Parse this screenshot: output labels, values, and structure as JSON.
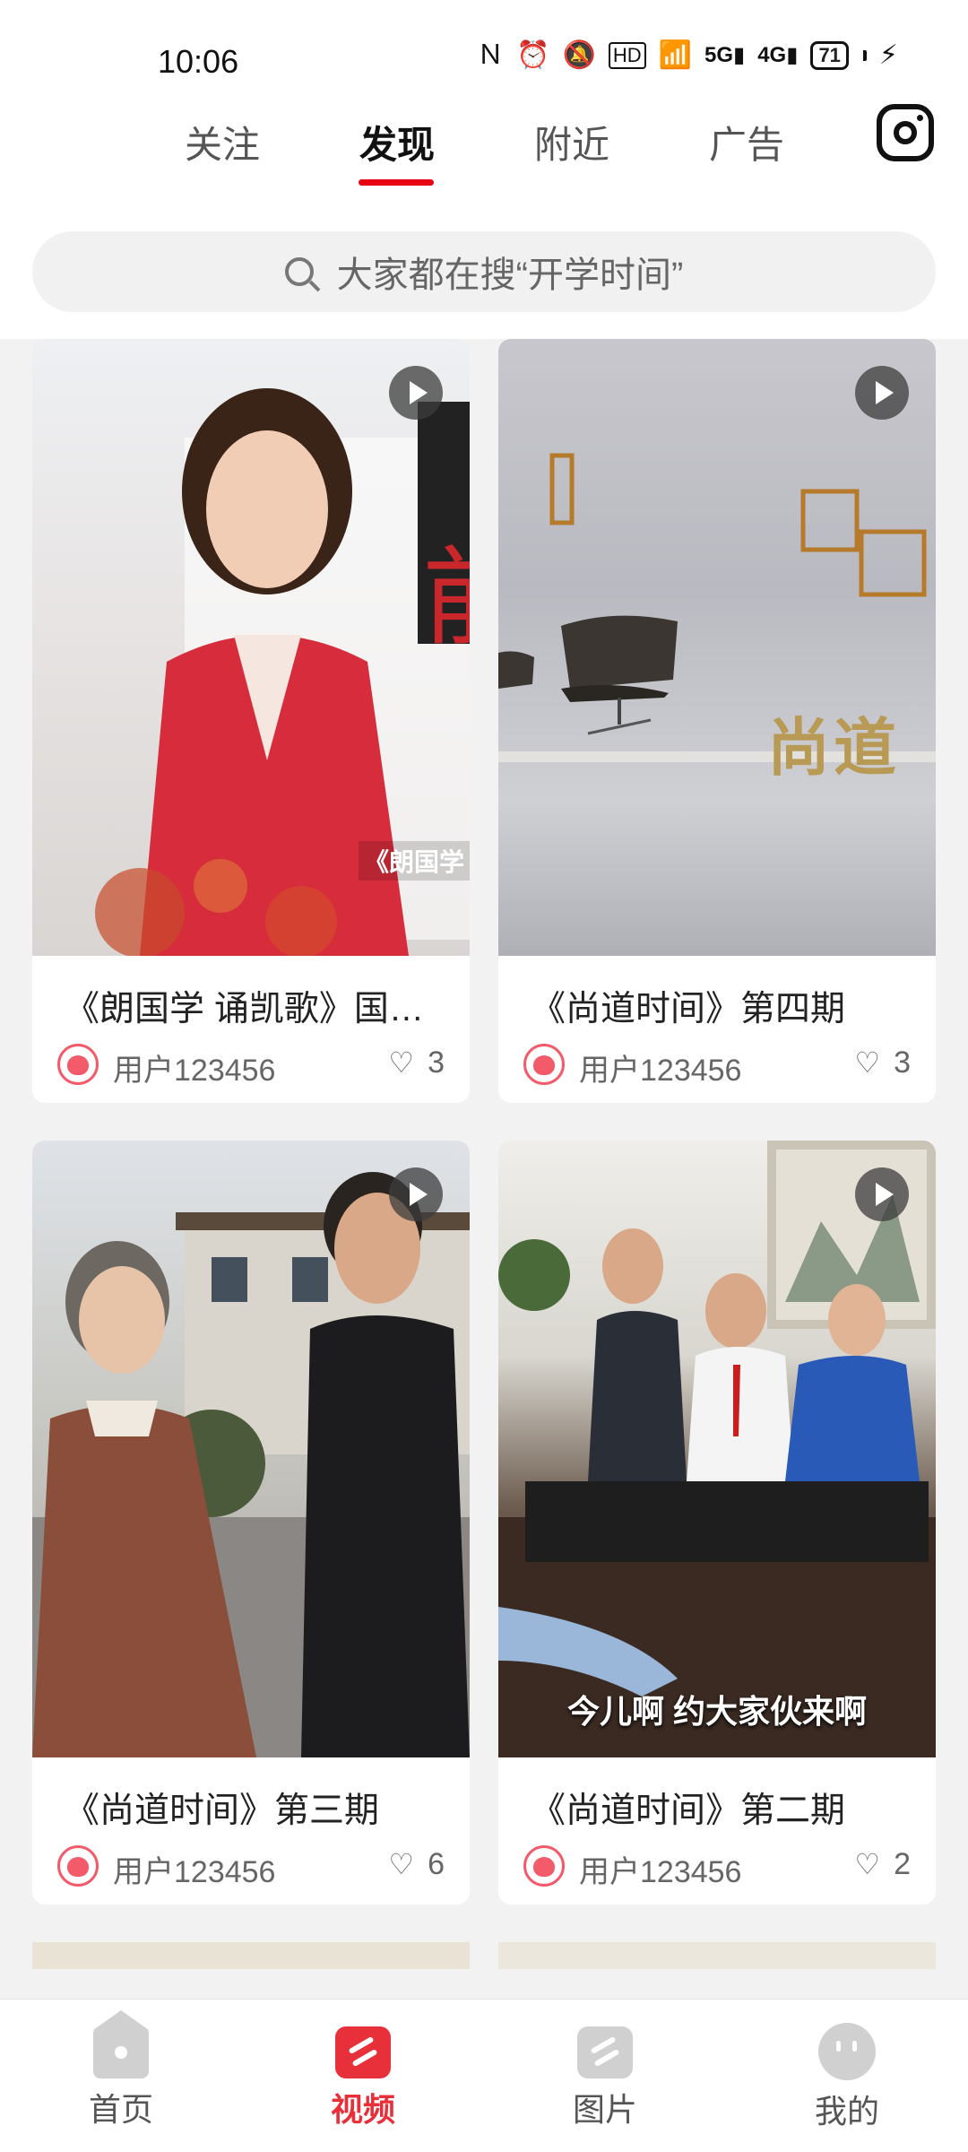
{
  "status_bar": {
    "time": "10:06",
    "icons": [
      "nfc-icon",
      "alarm-icon",
      "mute-icon",
      "hd-icon",
      "wifi-icon",
      "5g-signal-icon",
      "4g-signal-icon"
    ],
    "battery": "71"
  },
  "tabs": [
    {
      "label": "关注",
      "active": false
    },
    {
      "label": "发现",
      "active": true
    },
    {
      "label": "附近",
      "active": false
    },
    {
      "label": "广告",
      "active": false
    }
  ],
  "search": {
    "placeholder": "大家都在搜“开学时间”"
  },
  "cards": [
    {
      "title": "《朗国学 诵凯歌》国…",
      "user": "用户123456",
      "likes": "3",
      "overlay_text": "《朗国学"
    },
    {
      "title": "《尚道时间》第四期",
      "user": "用户123456",
      "likes": "3",
      "overlay_text": "尚道"
    },
    {
      "title": "《尚道时间》第三期",
      "user": "用户123456",
      "likes": "6",
      "overlay_text": ""
    },
    {
      "title": "《尚道时间》第二期",
      "user": "用户123456",
      "likes": "2",
      "overlay_text": "今儿啊  约大家伙来啊"
    }
  ],
  "bottom_nav": [
    {
      "label": "首页",
      "icon": "home-icon",
      "active": false
    },
    {
      "label": "视频",
      "icon": "video-icon",
      "active": true
    },
    {
      "label": "图片",
      "icon": "image-icon",
      "active": false
    },
    {
      "label": "我的",
      "icon": "profile-icon",
      "active": false
    }
  ],
  "colors": {
    "accent": "#e8303a",
    "underline": "#e60012"
  }
}
